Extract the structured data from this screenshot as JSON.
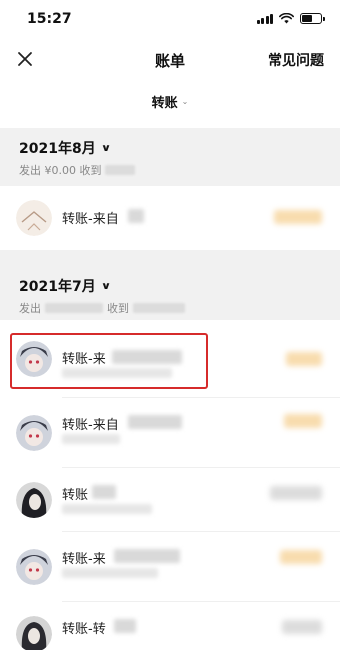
{
  "status_bar": {
    "time": "15:27"
  },
  "nav": {
    "title": "账单",
    "faq_label": "常见问题"
  },
  "filter": {
    "label": "转账",
    "caret": "⌄"
  },
  "months": [
    {
      "title": "2021年8月",
      "summary_prefix": "发出 ¥0.00 收到"
    },
    {
      "title": "2021年7月",
      "summary_prefix": "发出",
      "summary_middle": "收到"
    }
  ],
  "rows": [
    {
      "label": "转账-来自",
      "highlighted": false
    },
    {
      "label": "转账-来",
      "highlighted": true
    },
    {
      "label": "转账-来自",
      "highlighted": false
    },
    {
      "label": "转账",
      "highlighted": false
    },
    {
      "label": "转账-来",
      "highlighted": false
    },
    {
      "label": "转账-转",
      "highlighted": false
    }
  ],
  "colors": {
    "highlight_border": "#d62b2b",
    "amount_blur": "#f7d9a8",
    "section_bg": "#f1f1f1"
  }
}
